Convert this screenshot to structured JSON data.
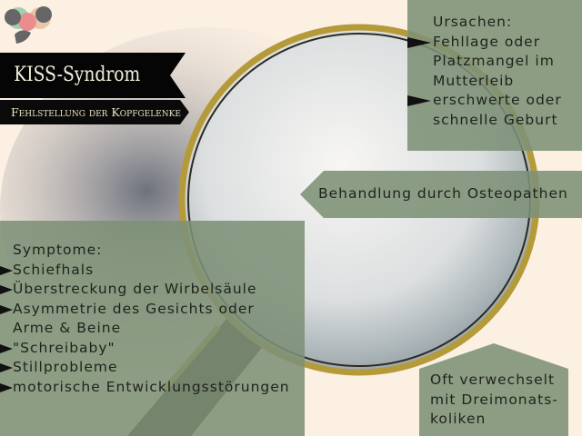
{
  "title": "KISS-Syndrom",
  "subtitle": "Fehlstellung der Kopfgelenke",
  "colors": {
    "background": "#fcf0e3",
    "box": "#7d9176",
    "banner": "#050505",
    "lens_rim": "#b59a3a"
  },
  "ursachen": {
    "heading": "Ursachen:",
    "items": [
      "Fehllage oder Platzmangel im Mutterleib",
      "erschwerte oder schnelle Geburt"
    ]
  },
  "behandlung": "Behandlung durch Osteopathen",
  "symptome": {
    "heading": "Symptome:",
    "items": [
      "Schiefhals",
      "Überstreckung der Wirbelsäule",
      "Asymmetrie des Gesichts oder Arme & Beine",
      "\"Schreibaby\"",
      "Stillprobleme",
      "motorische Entwicklungsstörungen"
    ]
  },
  "oft": "Oft verwechselt mit Dreimonats-koliken"
}
